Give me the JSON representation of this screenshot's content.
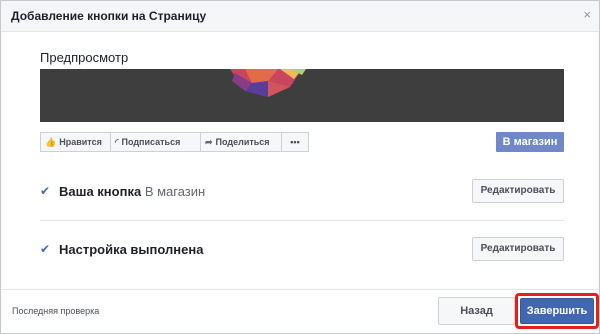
{
  "dialog": {
    "title": "Добавление кнопки на Страницу",
    "close_glyph": "×"
  },
  "preview": {
    "title": "Предпросмотр",
    "page_buttons": [
      {
        "label": "Нравится",
        "icon": "thumbs-up-icon"
      },
      {
        "label": "Подписаться",
        "icon": "rss-icon"
      },
      {
        "label": "Поделиться",
        "icon": "share-arrow-icon"
      }
    ],
    "more_glyph": "•••",
    "shop_button": "В магазин"
  },
  "steps": [
    {
      "title": "Ваша кнопка",
      "value": "В магазин",
      "action": "Редактировать"
    },
    {
      "title": "Настройка выполнена",
      "value": "",
      "action": "Редактировать"
    }
  ],
  "footer": {
    "last_check": "Последняя проверка",
    "back": "Назад",
    "finish": "Завершить"
  },
  "colors": {
    "accent": "#4267b2",
    "shop_button": "#7088c8",
    "highlight": "#e0221f"
  }
}
